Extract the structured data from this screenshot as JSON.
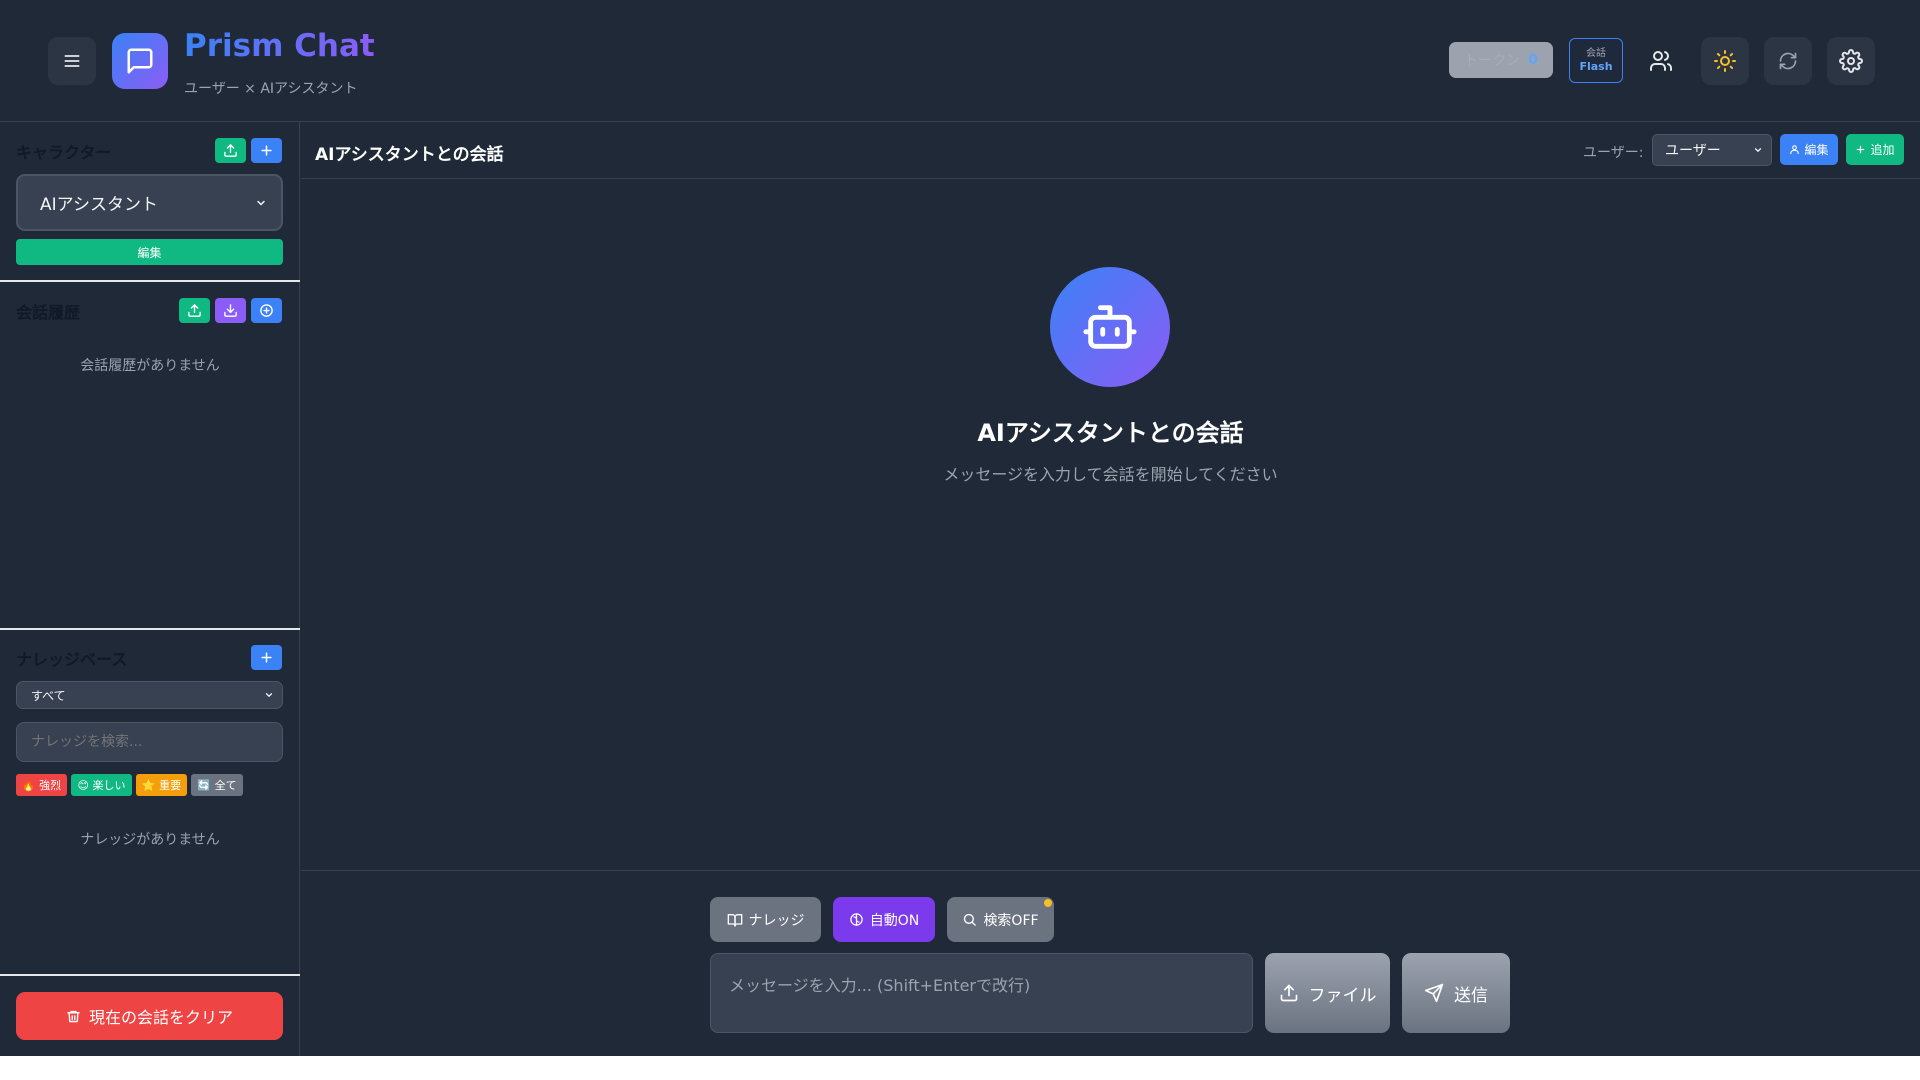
{
  "header": {
    "title": "Prism Chat",
    "subtitle": "ユーザー × AIアシスタント",
    "token_label": "トークン",
    "token_count": "0",
    "model_caption": "会話",
    "model_name": "Flash"
  },
  "sidebar": {
    "character": {
      "title": "キャラクター",
      "selected": "AIアシスタント",
      "edit_label": "編集"
    },
    "history": {
      "title": "会話履歴",
      "empty": "会話履歴がありません"
    },
    "knowledge": {
      "title": "ナレッジベース",
      "filter_selected": "すべて",
      "search_placeholder": "ナレッジを検索...",
      "tags": [
        {
          "label": "🔥 強烈",
          "color": "#ef4444"
        },
        {
          "label": "😊 楽しい",
          "color": "#10b981"
        },
        {
          "label": "⭐ 重要",
          "color": "#f59e0b"
        },
        {
          "label": "🔄 全て",
          "color": "#6b7280"
        }
      ],
      "empty": "ナレッジがありません"
    },
    "clear_label": "現在の会話をクリア"
  },
  "main": {
    "chat_title": "AIアシスタントとの会話",
    "user_label": "ユーザー:",
    "user_selected": "ユーザー",
    "edit_label": "編集",
    "add_label": "追加",
    "hero_title": "AIアシスタントとの会話",
    "hero_subtitle": "メッセージを入力して会話を開始してください"
  },
  "input": {
    "knowledge_label": "ナレッジ",
    "auto_label": "自動ON",
    "search_label": "検索OFF",
    "placeholder": "メッセージを入力... (Shift+Enterで改行)",
    "file_label": "ファイル",
    "send_label": "送信"
  },
  "colors": {
    "background": "#1f2937",
    "accent_blue": "#3b82f6",
    "accent_purple": "#8b5cf6",
    "accent_green": "#10b981",
    "danger": "#ef4444"
  }
}
